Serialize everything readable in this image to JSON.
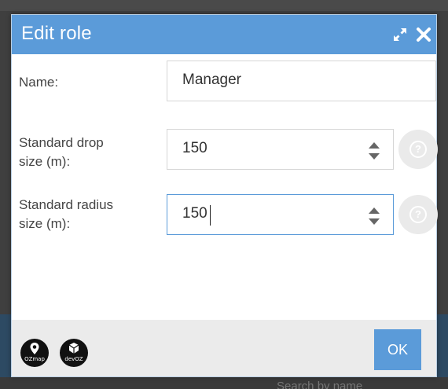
{
  "background": {
    "search_hint": "Search by name"
  },
  "dialog": {
    "title": "Edit role",
    "title_bar_color": "#5b9bd9",
    "icons": {
      "expand": "expand-icon",
      "close": "close-icon"
    }
  },
  "form": {
    "name": {
      "label": "Name:",
      "value": "Manager"
    },
    "drop_size": {
      "label_line1": "Standard drop",
      "label_line2": "size (m):",
      "value": "150",
      "help": "?"
    },
    "radius_size": {
      "label_line1": "Standard radius",
      "label_line2": "size (m):",
      "value": "150",
      "help": "?"
    }
  },
  "footer": {
    "logos": {
      "ozmap": "OZmap",
      "devoz": "devOZ"
    },
    "ok_label": "OK"
  }
}
